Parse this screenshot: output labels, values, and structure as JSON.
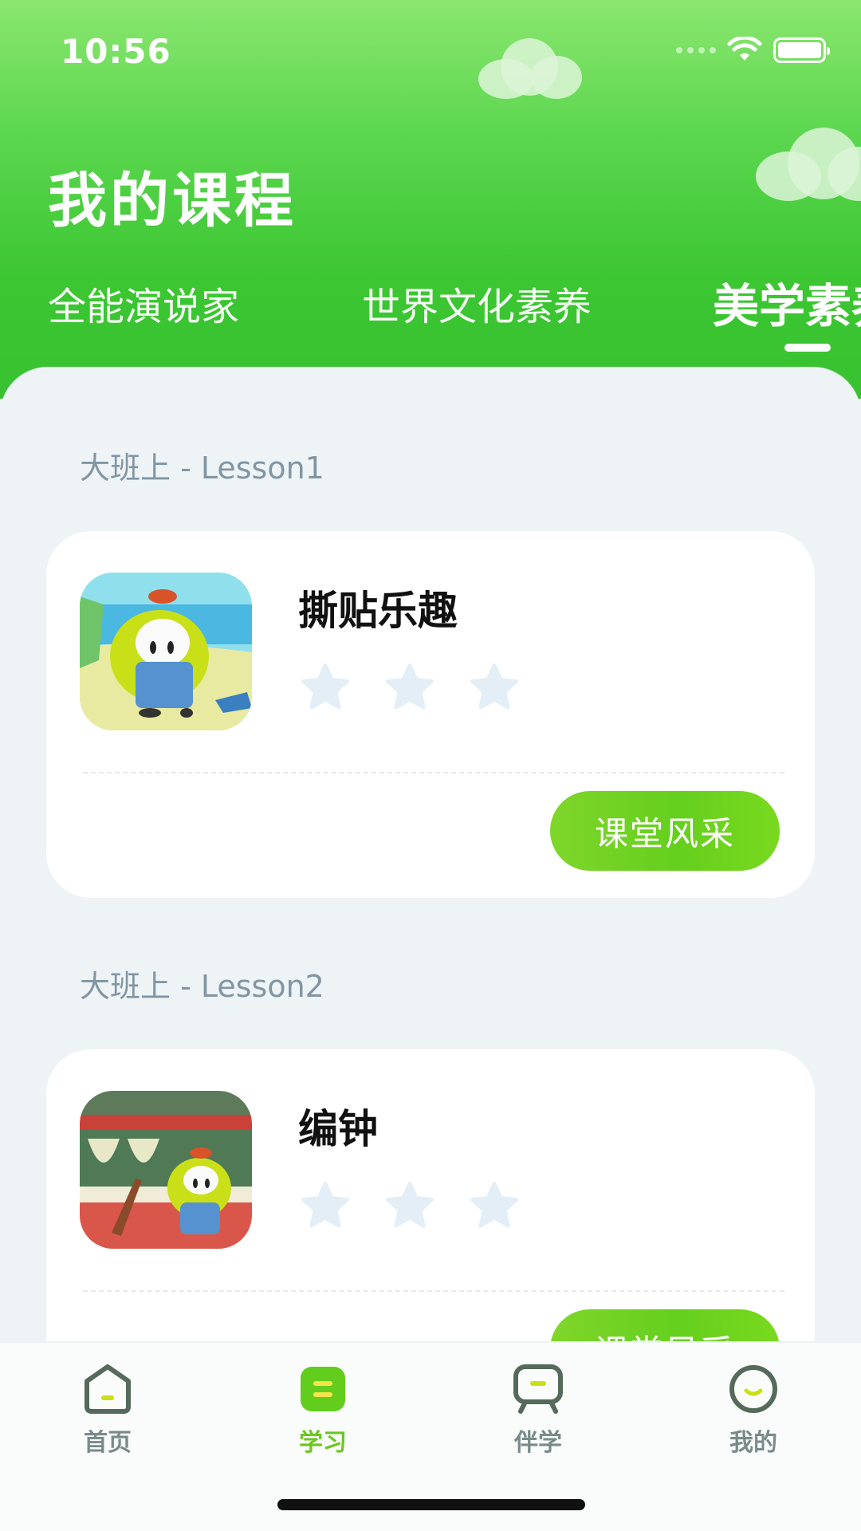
{
  "status_bar": {
    "time": "10:56"
  },
  "header": {
    "title": "我的课程",
    "tabs": [
      {
        "label": "全能演说家",
        "active": false
      },
      {
        "label": "世界文化素养",
        "active": false
      },
      {
        "label": "美学素养",
        "active": true
      }
    ]
  },
  "lessons": [
    {
      "label": "大班上 - Lesson1",
      "course_title": "撕贴乐趣",
      "stars_earned": 0,
      "stars_total": 3,
      "button_label": "课堂风采"
    },
    {
      "label": "大班上 - Lesson2",
      "course_title": "编钟",
      "stars_earned": 0,
      "stars_total": 3,
      "button_label": "课堂风采"
    }
  ],
  "tabbar": {
    "items": [
      {
        "label": "首页",
        "icon": "home-icon",
        "active": false
      },
      {
        "label": "学习",
        "icon": "study-icon",
        "active": true
      },
      {
        "label": "伴学",
        "icon": "companion-icon",
        "active": false
      },
      {
        "label": "我的",
        "icon": "profile-icon",
        "active": false
      }
    ]
  },
  "colors": {
    "header_green": "#3cc632",
    "button_green": "#65cf1e",
    "active_tab_label": "#6cc61e",
    "star_empty": "#e3eef7"
  }
}
